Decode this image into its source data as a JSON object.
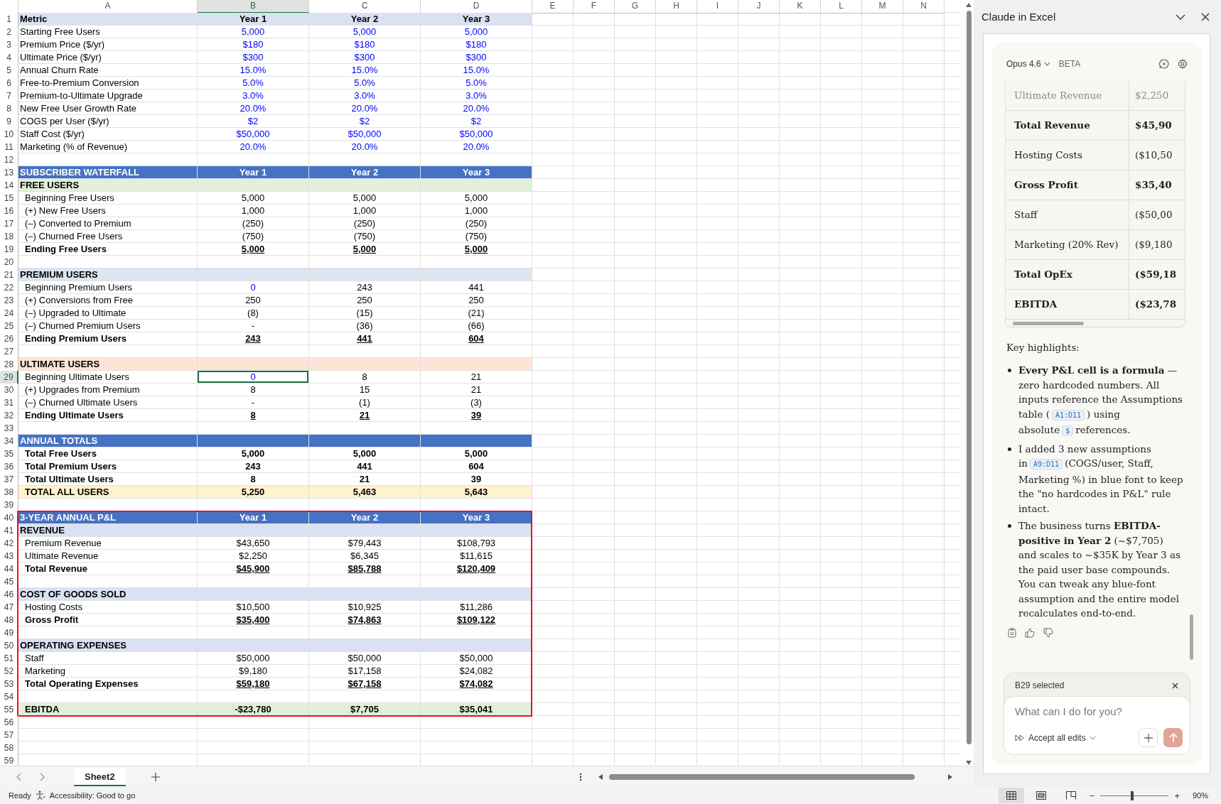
{
  "sheet": {
    "columns": [
      {
        "label": "A",
        "selected": false
      },
      {
        "label": "B",
        "selected": true
      },
      {
        "label": "C",
        "selected": false
      },
      {
        "label": "D",
        "selected": false
      },
      {
        "label": "E",
        "selected": false
      },
      {
        "label": "F",
        "selected": false
      },
      {
        "label": "G",
        "selected": false
      },
      {
        "label": "H",
        "selected": false
      },
      {
        "label": "I",
        "selected": false
      },
      {
        "label": "J",
        "selected": false
      },
      {
        "label": "K",
        "selected": false
      },
      {
        "label": "L",
        "selected": false
      },
      {
        "label": "M",
        "selected": false
      },
      {
        "label": "N",
        "selected": false
      }
    ],
    "rows": [
      {
        "n": "1",
        "kind": "header",
        "label": "Metric",
        "values": [
          "Year 1",
          "Year 2",
          "Year 3"
        ],
        "color": "#d9e1f2",
        "selected": false,
        "outlined": false
      },
      {
        "n": "2",
        "kind": "input",
        "label": "Starting Free Users",
        "values": [
          "5,000",
          "5,000",
          "5,000"
        ],
        "first_input": true,
        "selected": false,
        "outlined": false
      },
      {
        "n": "3",
        "kind": "input",
        "label": "Premium Price ($/yr)",
        "values": [
          "$180",
          "$180",
          "$180"
        ],
        "first_input": true,
        "selected": false,
        "outlined": false
      },
      {
        "n": "4",
        "kind": "input",
        "label": "Ultimate Price ($/yr)",
        "values": [
          "$300",
          "$300",
          "$300"
        ],
        "first_input": true,
        "selected": false,
        "outlined": false
      },
      {
        "n": "5",
        "kind": "input",
        "label": "Annual Churn Rate",
        "values": [
          "15.0%",
          "15.0%",
          "15.0%"
        ],
        "first_input": true,
        "selected": false,
        "outlined": false
      },
      {
        "n": "6",
        "kind": "input",
        "label": "Free-to-Premium Conversion",
        "values": [
          "5.0%",
          "5.0%",
          "5.0%"
        ],
        "first_input": true,
        "selected": false,
        "outlined": false
      },
      {
        "n": "7",
        "kind": "input",
        "label": "Premium-to-Ultimate Upgrade",
        "values": [
          "3.0%",
          "3.0%",
          "3.0%"
        ],
        "first_input": true,
        "selected": false,
        "outlined": false
      },
      {
        "n": "8",
        "kind": "input",
        "label": "New Free User Growth Rate",
        "values": [
          "20.0%",
          "20.0%",
          "20.0%"
        ],
        "first_input": true,
        "selected": false,
        "outlined": false
      },
      {
        "n": "9",
        "kind": "input",
        "label": "COGS per User ($/yr)",
        "values": [
          "$2",
          "$2",
          "$2"
        ],
        "first_input": true,
        "selected": false,
        "outlined": false
      },
      {
        "n": "10",
        "kind": "input",
        "label": "Staff Cost ($/yr)",
        "values": [
          "$50,000",
          "$50,000",
          "$50,000"
        ],
        "first_input": true,
        "selected": false,
        "outlined": false
      },
      {
        "n": "11",
        "kind": "input",
        "label": "Marketing (% of Revenue)",
        "values": [
          "20.0%",
          "20.0%",
          "20.0%"
        ],
        "first_input": true,
        "selected": false,
        "outlined": false
      },
      {
        "n": "12",
        "kind": "blank",
        "selected": false,
        "outlined": false
      },
      {
        "n": "13",
        "kind": "banner",
        "label": "SUBSCRIBER WATERFALL",
        "values": [
          "Year 1",
          "Year 2",
          "Year 3"
        ],
        "color": "#4472c4",
        "selected": false,
        "outlined": false
      },
      {
        "n": "14",
        "kind": "section",
        "label": "FREE USERS",
        "color": "#e2efda",
        "selected": false,
        "outlined": false
      },
      {
        "n": "15",
        "kind": "line",
        "label": "Beginning Free Users",
        "values": [
          "5,000",
          "5,000",
          "5,000"
        ],
        "first_input": false,
        "selected": false,
        "outlined": false
      },
      {
        "n": "16",
        "kind": "line",
        "label": "(+) New Free Users",
        "values": [
          "1,000",
          "1,000",
          "1,000"
        ],
        "first_input": false,
        "selected": false,
        "outlined": false
      },
      {
        "n": "17",
        "kind": "line",
        "label": "(–) Converted to Premium",
        "values": [
          "(250)",
          "(250)",
          "(250)"
        ],
        "first_input": false,
        "selected": false,
        "outlined": false
      },
      {
        "n": "18",
        "kind": "line",
        "label": "(–) Churned Free Users",
        "values": [
          "(750)",
          "(750)",
          "(750)"
        ],
        "first_input": false,
        "selected": false,
        "outlined": false
      },
      {
        "n": "19",
        "kind": "subtotal",
        "label": "Ending Free Users",
        "values": [
          "5,000",
          "5,000",
          "5,000"
        ],
        "first_input": false,
        "selected": false,
        "outlined": false
      },
      {
        "n": "20",
        "kind": "blank",
        "selected": false,
        "outlined": false
      },
      {
        "n": "21",
        "kind": "section",
        "label": "PREMIUM USERS",
        "color": "#dce6f1",
        "selected": false,
        "outlined": false
      },
      {
        "n": "22",
        "kind": "line",
        "label": "Beginning Premium Users",
        "values": [
          "0",
          "243",
          "441"
        ],
        "first_input": true,
        "selected": false,
        "outlined": false
      },
      {
        "n": "23",
        "kind": "line",
        "label": "(+) Conversions from Free",
        "values": [
          "250",
          "250",
          "250"
        ],
        "first_input": false,
        "selected": false,
        "outlined": false
      },
      {
        "n": "24",
        "kind": "line",
        "label": "(–) Upgraded to Ultimate",
        "values": [
          "(8)",
          "(15)",
          "(21)"
        ],
        "first_input": false,
        "selected": false,
        "outlined": false
      },
      {
        "n": "25",
        "kind": "line",
        "label": "(–) Churned Premium Users",
        "values": [
          "-",
          "(36)",
          "(66)"
        ],
        "first_input": false,
        "selected": false,
        "outlined": false
      },
      {
        "n": "26",
        "kind": "subtotal",
        "label": "Ending Premium Users",
        "values": [
          "243",
          "441",
          "604"
        ],
        "first_input": false,
        "selected": false,
        "outlined": false
      },
      {
        "n": "27",
        "kind": "blank",
        "selected": false,
        "outlined": false
      },
      {
        "n": "28",
        "kind": "section",
        "label": "ULTIMATE USERS",
        "color": "#fce4d6",
        "selected": false,
        "outlined": false
      },
      {
        "n": "29",
        "kind": "line",
        "label": "Beginning Ultimate Users",
        "values": [
          "0",
          "8",
          "21"
        ],
        "first_input": true,
        "selected": true,
        "outlined": false
      },
      {
        "n": "30",
        "kind": "line",
        "label": "(+) Upgrades from Premium",
        "values": [
          "8",
          "15",
          "21"
        ],
        "first_input": false,
        "selected": false,
        "outlined": false
      },
      {
        "n": "31",
        "kind": "line",
        "label": "(–) Churned Ultimate Users",
        "values": [
          "-",
          "(1)",
          "(3)"
        ],
        "first_input": false,
        "selected": false,
        "outlined": false
      },
      {
        "n": "32",
        "kind": "subtotal",
        "label": "Ending Ultimate Users",
        "values": [
          "8",
          "21",
          "39"
        ],
        "first_input": false,
        "selected": false,
        "outlined": false
      },
      {
        "n": "33",
        "kind": "blank",
        "selected": false,
        "outlined": false
      },
      {
        "n": "34",
        "kind": "banner",
        "label": "ANNUAL TOTALS",
        "color": "#4472c4",
        "selected": false,
        "outlined": false
      },
      {
        "n": "35",
        "kind": "total",
        "label": "Total Free Users",
        "values": [
          "5,000",
          "5,000",
          "5,000"
        ],
        "first_input": false,
        "selected": false,
        "outlined": false
      },
      {
        "n": "36",
        "kind": "total",
        "label": "Total Premium Users",
        "values": [
          "243",
          "441",
          "604"
        ],
        "first_input": false,
        "selected": false,
        "outlined": false
      },
      {
        "n": "37",
        "kind": "total",
        "label": "Total Ultimate Users",
        "values": [
          "8",
          "21",
          "39"
        ],
        "first_input": false,
        "selected": false,
        "outlined": false
      },
      {
        "n": "38",
        "kind": "total",
        "label": "TOTAL ALL USERS",
        "values": [
          "5,250",
          "5,463",
          "5,643"
        ],
        "color": "#fff2cc",
        "first_input": false,
        "selected": false,
        "outlined": false
      },
      {
        "n": "39",
        "kind": "blank",
        "selected": false,
        "outlined": false
      },
      {
        "n": "40",
        "kind": "banner",
        "label": "3-YEAR ANNUAL P&L",
        "values": [
          "Year 1",
          "Year 2",
          "Year 3"
        ],
        "color": "#4472c4",
        "selected": false,
        "outlined": true
      },
      {
        "n": "41",
        "kind": "section",
        "label": "REVENUE",
        "color": "#d9e1f2",
        "selected": false,
        "outlined": true
      },
      {
        "n": "42",
        "kind": "line",
        "label": "Premium Revenue",
        "values": [
          "$43,650",
          "$79,443",
          "$108,793"
        ],
        "first_input": false,
        "selected": false,
        "outlined": true
      },
      {
        "n": "43",
        "kind": "line",
        "label": "Ultimate Revenue",
        "values": [
          "$2,250",
          "$6,345",
          "$11,615"
        ],
        "first_input": false,
        "selected": false,
        "outlined": true
      },
      {
        "n": "44",
        "kind": "subtotal",
        "label": "Total Revenue",
        "values": [
          "$45,900",
          "$85,788",
          "$120,409"
        ],
        "first_input": false,
        "selected": false,
        "outlined": true
      },
      {
        "n": "45",
        "kind": "blank",
        "selected": false,
        "outlined": true
      },
      {
        "n": "46",
        "kind": "section",
        "label": "COST OF GOODS SOLD",
        "color": "#d9e1f2",
        "selected": false,
        "outlined": true
      },
      {
        "n": "47",
        "kind": "line",
        "label": "Hosting Costs",
        "values": [
          "$10,500",
          "$10,925",
          "$11,286"
        ],
        "first_input": false,
        "selected": false,
        "outlined": true
      },
      {
        "n": "48",
        "kind": "subtotal",
        "label": "Gross Profit",
        "values": [
          "$35,400",
          "$74,863",
          "$109,122"
        ],
        "first_input": false,
        "selected": false,
        "outlined": true
      },
      {
        "n": "49",
        "kind": "blank",
        "selected": false,
        "outlined": true
      },
      {
        "n": "50",
        "kind": "section",
        "label": "OPERATING EXPENSES",
        "color": "#d9e1f2",
        "selected": false,
        "outlined": true
      },
      {
        "n": "51",
        "kind": "line",
        "label": "Staff",
        "values": [
          "$50,000",
          "$50,000",
          "$50,000"
        ],
        "first_input": false,
        "selected": false,
        "outlined": true
      },
      {
        "n": "52",
        "kind": "line",
        "label": "Marketing",
        "values": [
          "$9,180",
          "$17,158",
          "$24,082"
        ],
        "first_input": false,
        "selected": false,
        "outlined": true
      },
      {
        "n": "53",
        "kind": "subtotal",
        "label": "Total Operating Expenses",
        "values": [
          "$59,180",
          "$67,158",
          "$74,082"
        ],
        "first_input": false,
        "selected": false,
        "outlined": true
      },
      {
        "n": "54",
        "kind": "blank",
        "selected": false,
        "outlined": true
      },
      {
        "n": "55",
        "kind": "total",
        "label": "EBITDA",
        "values": [
          "-$23,780",
          "$7,705",
          "$35,041"
        ],
        "color": "#e2efda",
        "first_input": false,
        "selected": false,
        "outlined": true
      },
      {
        "n": "56",
        "kind": "blank",
        "selected": false,
        "outlined": false
      },
      {
        "n": "57",
        "kind": "blank",
        "selected": false,
        "outlined": false
      },
      {
        "n": "58",
        "kind": "blank",
        "selected": false,
        "outlined": false
      },
      {
        "n": "59",
        "kind": "blank",
        "selected": false,
        "outlined": false
      }
    ]
  },
  "sheet_tabs": [
    {
      "label": "Sheet2",
      "selected": true
    }
  ],
  "status_bar": {
    "ready": "Ready",
    "accessibility": "Accessibility: Good to go",
    "views": [
      {
        "kind": "normal",
        "selected": true
      },
      {
        "kind": "page_layout",
        "selected": false
      },
      {
        "kind": "page_break",
        "selected": false
      }
    ],
    "zoom": {
      "minus": "−",
      "plus": "+",
      "level": 0.46,
      "reading": "90%"
    }
  },
  "pane": {
    "title": "Claude in Excel",
    "model": "Opus 4.6",
    "badge": "BETA",
    "table": [
      {
        "label": "Ultimate Revenue",
        "value": "$2,250",
        "bold": false,
        "faded": true
      },
      {
        "label": "Total Revenue",
        "value": "$45,90",
        "bold": true,
        "faded": false
      },
      {
        "label": "Hosting Costs",
        "value": "($10,50",
        "bold": false,
        "faded": false
      },
      {
        "label": "Gross Profit",
        "value": "$35,40",
        "bold": true,
        "faded": false
      },
      {
        "label": "Staff",
        "value": "($50,00",
        "bold": false,
        "faded": false
      },
      {
        "label": "Marketing (20% Rev)",
        "value": "($9,180",
        "bold": false,
        "faded": false
      },
      {
        "label": "Total OpEx",
        "value": "($59,18",
        "bold": true,
        "faded": false
      },
      {
        "label": "EBITDA",
        "value": "($23,78",
        "bold": true,
        "faded": false
      }
    ],
    "heading": "Key highlights:",
    "bullets": [
      [
        {
          "kind": "text",
          "text": "**Every P&L cell is a formula** — zero hardcoded numbers. All inputs reference the Assumptions table ("
        },
        {
          "kind": "code",
          "text": "A1:D11"
        },
        {
          "kind": "text",
          "text": ") using absolute"
        },
        {
          "kind": "code",
          "text": "$"
        },
        {
          "kind": "text",
          "text": "references."
        }
      ],
      [
        {
          "kind": "text",
          "text": "I added 3 new assumptions in"
        },
        {
          "kind": "code",
          "text": "A9:D11"
        },
        {
          "kind": "text",
          "text": "(COGS/user, Staff, Marketing %) in blue font to keep the \"no hardcodes in P&L\" rule intact."
        }
      ],
      [
        {
          "kind": "text",
          "text": "The business turns **EBITDA-positive in Year 2** (~$7,705) and scales to ~$35K by Year 3 as the paid user base compounds. You can tweak any blue-font assumption and the entire model recalculates end-to-end."
        }
      ]
    ],
    "context": "B29 selected",
    "placeholder": "What can I do for you?",
    "accept": "Accept all edits"
  }
}
